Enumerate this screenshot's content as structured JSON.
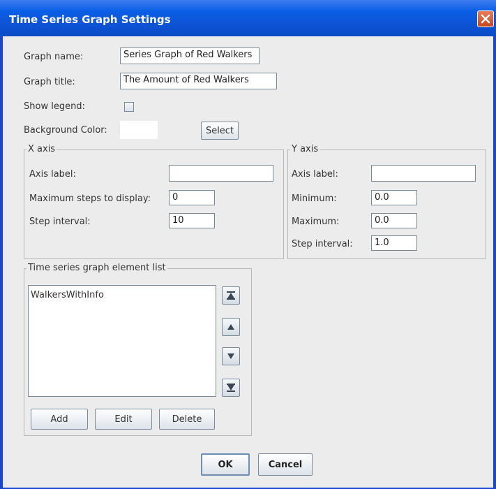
{
  "window": {
    "title": "Time Series Graph Settings"
  },
  "form": {
    "graph_name_label": "Graph name:",
    "graph_name_value": "Series Graph of Red Walkers",
    "graph_title_label": "Graph title:",
    "graph_title_value": "The Amount of Red Walkers",
    "show_legend_label": "Show legend:",
    "show_legend_checked": false,
    "background_color_label": "Background Color:",
    "background_color_value": "#ffffff",
    "select_label": "Select"
  },
  "x_axis": {
    "title": "X axis",
    "axis_label_label": "Axis label:",
    "axis_label_value": "",
    "max_steps_label": "Maximum steps to display:",
    "max_steps_value": "0",
    "step_interval_label": "Step interval:",
    "step_interval_value": "10"
  },
  "y_axis": {
    "title": "Y axis",
    "axis_label_label": "Axis label:",
    "axis_label_value": "",
    "minimum_label": "Minimum:",
    "minimum_value": "0.0",
    "maximum_label": "Maximum:",
    "maximum_value": "0.0",
    "step_interval_label": "Step interval:",
    "step_interval_value": "1.0"
  },
  "element_list": {
    "title": "Time series graph element list",
    "items": [
      "WalkersWithInfo"
    ],
    "add_label": "Add",
    "edit_label": "Edit",
    "delete_label": "Delete",
    "icons": [
      "move-top-icon",
      "move-up-icon",
      "move-down-icon",
      "move-bottom-icon"
    ]
  },
  "footer": {
    "ok_label": "OK",
    "cancel_label": "Cancel"
  },
  "colors": {
    "titlebar": "#0d55d8",
    "dialog_bg": "#ececec",
    "close": "#d8552b"
  }
}
